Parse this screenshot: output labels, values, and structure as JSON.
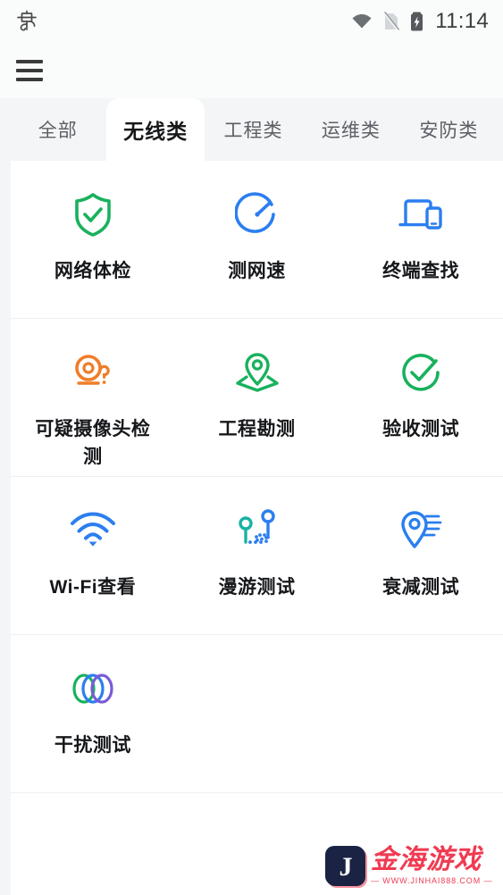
{
  "statusbar": {
    "left_glyph": "电",
    "time": "11:14",
    "icons": [
      "wifi-icon",
      "sim-card-off-icon",
      "battery-charging-icon"
    ]
  },
  "appbar": {
    "menu_icon": "hamburger-menu-icon"
  },
  "tabs": [
    {
      "label": "全部",
      "active": false
    },
    {
      "label": "无线类",
      "active": true
    },
    {
      "label": "工程类",
      "active": false
    },
    {
      "label": "运维类",
      "active": false
    },
    {
      "label": "安防类",
      "active": false
    }
  ],
  "grid": {
    "rows": [
      [
        {
          "label": "网络体检",
          "icon": "shield-check-icon",
          "color": "#19b15d"
        },
        {
          "label": "测网速",
          "icon": "speedometer-icon",
          "color": "#2b7ef0"
        },
        {
          "label": "终端查找",
          "icon": "laptop-phone-icon",
          "color": "#2b7ef0"
        }
      ],
      [
        {
          "label": "可疑摄像头检测",
          "icon": "camera-question-icon",
          "color": "#f07d28"
        },
        {
          "label": "工程勘测",
          "icon": "map-pin-plane-icon",
          "color": "#19b15d"
        },
        {
          "label": "验收测试",
          "icon": "circle-check-icon",
          "color": "#19b15d"
        }
      ],
      [
        {
          "label": "Wi-Fi查看",
          "icon": "wifi-signal-icon",
          "color": "#2b7ef0"
        },
        {
          "label": "漫游测试",
          "icon": "roaming-pins-icon",
          "color": "#2b7ef0"
        },
        {
          "label": "衰减测试",
          "icon": "pin-attenuation-icon",
          "color": "#2b7ef0"
        }
      ],
      [
        {
          "label": "干扰测试",
          "icon": "three-rings-icon",
          "color": "#7a5bd6"
        },
        {
          "label": "",
          "icon": "",
          "color": ""
        },
        {
          "label": "",
          "icon": "",
          "color": ""
        }
      ]
    ]
  },
  "watermark": {
    "title": "金海游戏",
    "url": "— WWW.JINHAI888.COM —",
    "logo_letter": "J",
    "color": "#ef3b52"
  },
  "colors": {
    "green": "#19b15d",
    "blue": "#2b7ef0",
    "orange": "#f07d28",
    "purple": "#7a5bd6",
    "teal": "#18b2a4",
    "tabbar_bg": "#f4f5f6",
    "divider": "#eef0f1"
  }
}
